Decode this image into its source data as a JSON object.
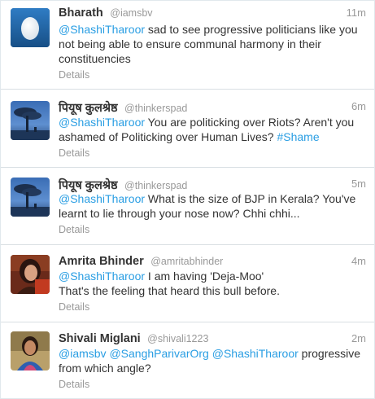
{
  "tweets": [
    {
      "fullname": "Bharath",
      "username": "@iamsbv",
      "time": "11m",
      "mention1": "@ShashiTharoor",
      "text1": " sad to see progressive politicians like you not being able to ensure communal harmony in their constituencies",
      "details": "Details",
      "avatar": "egg-avatar"
    },
    {
      "fullname": "पियूष कुलश्रेष्ठ",
      "username": "@thinkerspad",
      "time": "6m",
      "mention1": "@ShashiTharoor",
      "text1": " You are politicking over Riots? Aren't you ashamed of Politicking over Human Lives? ",
      "hashtag": "#Shame",
      "details": "Details",
      "avatar": "tree-avatar"
    },
    {
      "fullname": "पियूष कुलश्रेष्ठ",
      "username": "@thinkerspad",
      "time": "5m",
      "mention1": "@ShashiTharoor",
      "text1": " What is the size of BJP in Kerala? You've learnt to lie through your nose now? Chhi chhi...",
      "details": "Details",
      "avatar": "tree-avatar"
    },
    {
      "fullname": "Amrita Bhinder",
      "username": "@amritabhinder",
      "time": "4m",
      "mention1": "@ShashiTharoor",
      "text1": " I am having 'Deja-Moo'",
      "text2": "That's the feeling that heard this bull before.",
      "details": "Details",
      "avatar": "woman-avatar"
    },
    {
      "fullname": "Shivali Miglani",
      "username": "@shivali1223",
      "time": "2m",
      "mention1": "@iamsbv",
      "mention2": "@SanghParivarOrg",
      "mention3": "@ShashiTharoor",
      "text1": " progressive from which angle?",
      "details": "Details",
      "avatar": "woman-avatar"
    }
  ],
  "colors": {
    "link": "#2a9ee3",
    "muted": "#999999",
    "text": "#333333"
  }
}
